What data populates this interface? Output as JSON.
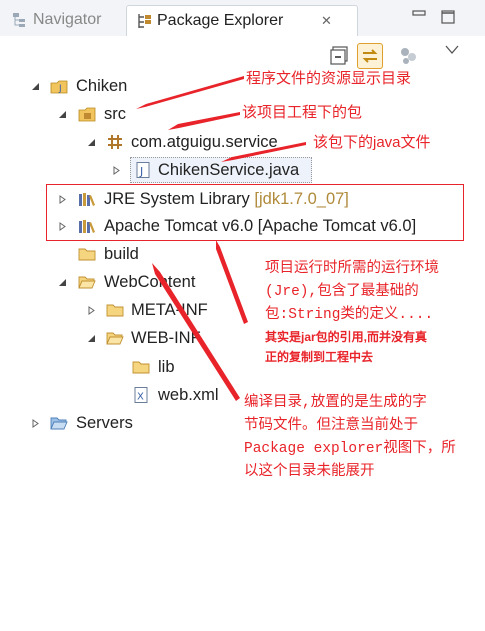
{
  "tabs": {
    "navigator": "Navigator",
    "package_explorer": "Package Explorer"
  },
  "tree": [
    {
      "label": "Chiken"
    },
    {
      "label": "src"
    },
    {
      "label": "com.atguigu.service"
    },
    {
      "label": "ChikenService.java"
    },
    {
      "label": "JRE System Library",
      "decoration": "[jdk1.7.0_07]"
    },
    {
      "label": "Apache Tomcat v6.0 [Apache Tomcat v6.0]"
    },
    {
      "label": "build"
    },
    {
      "label": "WebContent"
    },
    {
      "label": "META-INF"
    },
    {
      "label": "WEB-INF"
    },
    {
      "label": "lib"
    },
    {
      "label": "web.xml"
    },
    {
      "label": "Servers"
    }
  ],
  "annotations": {
    "resource_dir": "程序文件的资源显示目录",
    "project_package": "该项目工程下的包",
    "java_file": "该包下的java文件",
    "runtime_env": [
      "项目运行时所需的运行环境",
      "(Jre),包含了最基础的",
      "包:String类的定义...."
    ],
    "jar_note": [
      "其实是jar包的引用,而并没有真",
      "正的复制到工程中去"
    ],
    "build_note": [
      "编译目录,放置的是生成的字",
      "节码文件。但注意当前处于",
      "Package explorer视图下，所",
      "以这个目录未能展开"
    ]
  },
  "colors": {
    "annotation": "#e8242a",
    "folder": "#e8b04a",
    "decoration": "#b08a3a"
  }
}
